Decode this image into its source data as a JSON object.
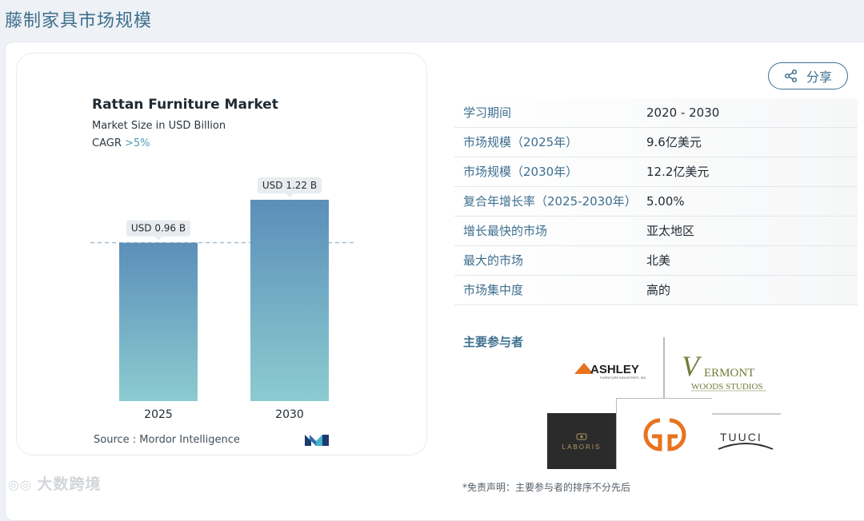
{
  "page": {
    "title": "藤制家具市场规模"
  },
  "share": {
    "label": "分享",
    "icon": "share-icon"
  },
  "chart": {
    "title": "Rattan Furniture Market",
    "subtitle": "Market Size in USD Billion",
    "cagr_label": "CAGR ",
    "cagr_value": ">5%",
    "source": "Source : Mordor Intelligence",
    "colors": {
      "bar_top": "#5b8fb9",
      "bar_bottom": "#8ccbd0",
      "label_bg": "#e9ecef",
      "dash": "#7ea6c4"
    }
  },
  "chart_data": {
    "type": "bar",
    "categories": [
      "2025",
      "2030"
    ],
    "values": [
      0.96,
      1.22
    ],
    "data_labels": [
      "USD 0.96 B",
      "USD 1.22 B"
    ],
    "ylim": [
      0,
      1.22
    ],
    "grid": false,
    "reference_line_value": 0.96
  },
  "info_table": {
    "rows": [
      {
        "key": "学习期间",
        "value": "2020 - 2030"
      },
      {
        "key": "市场规模（2025年）",
        "value": "9.6亿美元"
      },
      {
        "key": "市场规模（2030年）",
        "value": "12.2亿美元"
      },
      {
        "key": "复合年增长率（2025-2030年）",
        "value": "5.00%"
      },
      {
        "key": "增长最快的市场",
        "value": "亚太地区"
      },
      {
        "key": "最大的市场",
        "value": "北美"
      },
      {
        "key": "市场集中度",
        "value": "高的"
      }
    ]
  },
  "players": {
    "label": "主要参与者",
    "logos": {
      "ashley": "ASHLEY",
      "ashley_sub": "FURNITURE INDUSTRIES, INC.",
      "vermont_v": "V",
      "vermont_1": "ERMONT",
      "vermont_2": "WOODS STUDIOS",
      "laboris": "LABORIS",
      "tuuci": "TUUCI"
    }
  },
  "disclaimer": "*免责声明：主要参与者的排序不分先后",
  "watermark": "大数跨境"
}
